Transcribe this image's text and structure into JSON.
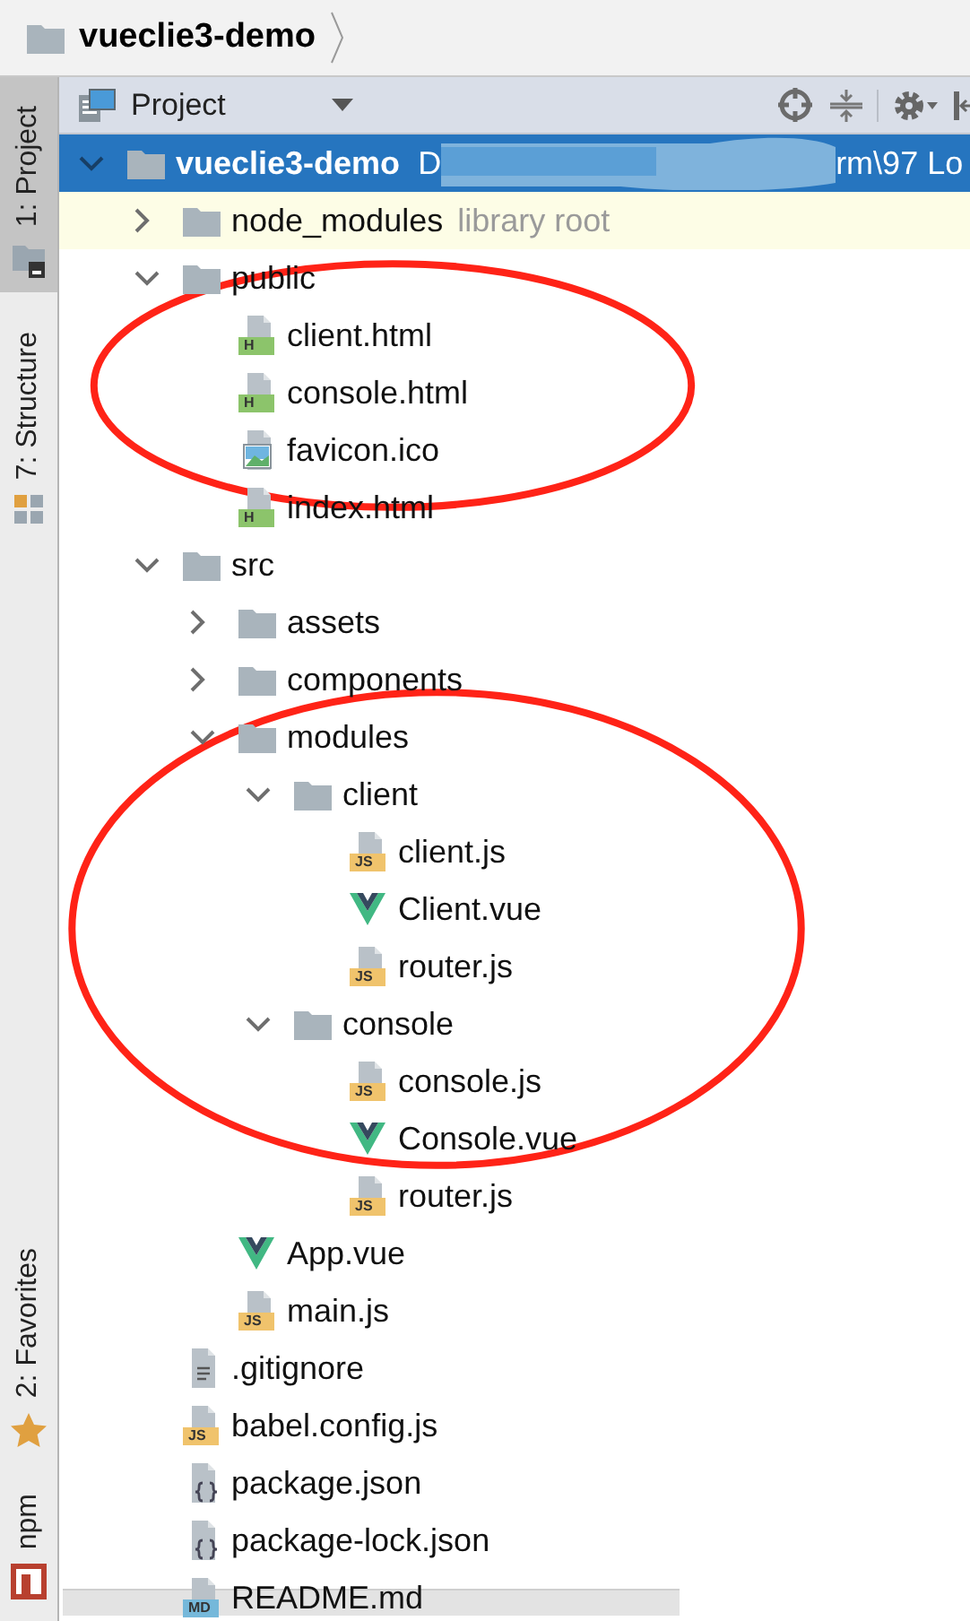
{
  "breadcrumb": {
    "items": [
      {
        "label": "vueclie3-demo"
      }
    ]
  },
  "tool_strip": {
    "top": [
      {
        "label": "1: Project",
        "kind": "project",
        "selected": true
      },
      {
        "label": "7: Structure",
        "kind": "structure",
        "selected": false
      }
    ],
    "bottom": [
      {
        "label": "2: Favorites",
        "kind": "favorites",
        "selected": false
      },
      {
        "label": "npm",
        "kind": "npm",
        "selected": false
      }
    ]
  },
  "panel": {
    "title": "Project"
  },
  "tree": {
    "name": "vueclie3-demo",
    "kind": "folder",
    "expanded": true,
    "selected": true,
    "path_start": "D",
    "path_end": "rm\\97 Lo",
    "children": [
      {
        "name": "node_modules",
        "kind": "folder",
        "expanded": false,
        "selected": false,
        "library": true,
        "note": "library root"
      },
      {
        "name": "public",
        "kind": "folder",
        "expanded": true,
        "selected": false,
        "circled": true,
        "children": [
          {
            "name": "client.html",
            "kind": "html",
            "badge": "H",
            "selected": false
          },
          {
            "name": "console.html",
            "kind": "html",
            "badge": "H",
            "selected": false
          },
          {
            "name": "favicon.ico",
            "kind": "image",
            "selected": false
          },
          {
            "name": "index.html",
            "kind": "html",
            "badge": "H",
            "selected": false
          }
        ]
      },
      {
        "name": "src",
        "kind": "folder",
        "expanded": true,
        "selected": false,
        "children": [
          {
            "name": "assets",
            "kind": "folder",
            "expanded": false,
            "selected": false
          },
          {
            "name": "components",
            "kind": "folder",
            "expanded": false,
            "selected": false
          },
          {
            "name": "modules",
            "kind": "folder",
            "expanded": true,
            "selected": false,
            "circled": true,
            "children": [
              {
                "name": "client",
                "kind": "folder",
                "expanded": true,
                "selected": false,
                "children": [
                  {
                    "name": "client.js",
                    "kind": "js",
                    "badge": "JS",
                    "selected": false
                  },
                  {
                    "name": "Client.vue",
                    "kind": "vue",
                    "selected": false
                  },
                  {
                    "name": "router.js",
                    "kind": "js",
                    "badge": "JS",
                    "selected": false
                  }
                ]
              },
              {
                "name": "console",
                "kind": "folder",
                "expanded": true,
                "selected": false,
                "children": [
                  {
                    "name": "console.js",
                    "kind": "js",
                    "badge": "JS",
                    "selected": false
                  },
                  {
                    "name": "Console.vue",
                    "kind": "vue",
                    "selected": false
                  },
                  {
                    "name": "router.js",
                    "kind": "js",
                    "badge": "JS",
                    "selected": false
                  }
                ]
              }
            ]
          },
          {
            "name": "App.vue",
            "kind": "vue",
            "selected": false
          },
          {
            "name": "main.js",
            "kind": "js",
            "badge": "JS",
            "selected": false
          }
        ]
      },
      {
        "name": ".gitignore",
        "kind": "text",
        "selected": false
      },
      {
        "name": "babel.config.js",
        "kind": "js",
        "badge": "JS",
        "selected": false
      },
      {
        "name": "package.json",
        "kind": "json",
        "selected": false
      },
      {
        "name": "package-lock.json",
        "kind": "json",
        "selected": false
      },
      {
        "name": "README.md",
        "kind": "md",
        "badge": "MD",
        "selected": false
      }
    ]
  }
}
